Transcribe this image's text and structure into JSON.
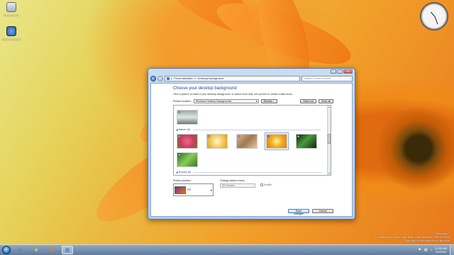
{
  "desktop": {
    "icons": [
      {
        "label": "Recycle Bin",
        "icon": "recycle-bin-icon"
      },
      {
        "label": "Send feedback",
        "icon": "feedback-icon"
      }
    ],
    "watermark": {
      "line1": "Windows 7",
      "line2": "For testing purposes only. Build 7048.winmain.090219-1845",
      "line3": "This copy of Windows is not genuine"
    }
  },
  "window": {
    "breadcrumb": [
      "Personalization",
      "Desktop Background"
    ],
    "search_placeholder": "Search Control Panel",
    "heading": "Choose your desktop background",
    "subtext": "Click a picture to make it your desktop background, or select more than one picture to create a slide show.",
    "picture_location_label": "Picture location:",
    "picture_location_value": "Windows Desktop Backgrounds",
    "browse_label": "Browse...",
    "select_all_label": "Select all",
    "clear_all_label": "Clear all",
    "groups": [
      {
        "header": "Nature (6)"
      },
      {
        "header": "Scenes (6)"
      }
    ],
    "picture_position_label": "Picture position:",
    "picture_position_value": "Fill",
    "change_picture_label": "Change picture every:",
    "change_picture_value": "30 minutes",
    "shuffle_label": "Shuffle",
    "save_label": "Save changes",
    "cancel_label": "Cancel"
  },
  "taskbar": {
    "clock_time": "10:32 AM",
    "clock_date": "3/2/2009"
  },
  "colors": {
    "accent": "#1e3f8a",
    "taskbar": "#6f88a8"
  }
}
